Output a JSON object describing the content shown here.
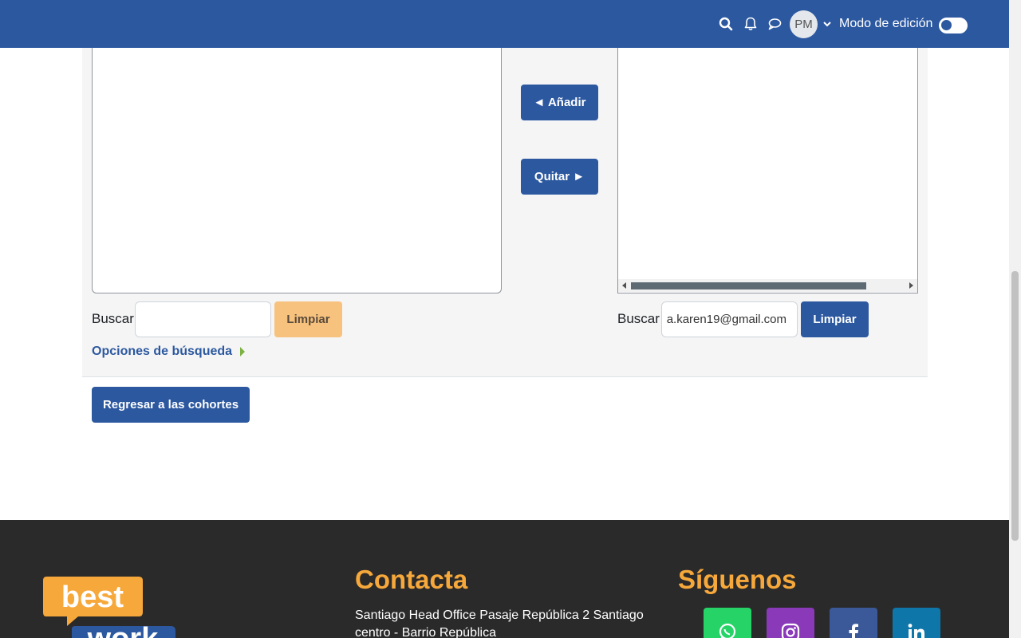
{
  "navbar": {
    "avatar_initials": "PM",
    "edit_mode_label": "Modo de edición"
  },
  "assign": {
    "add_button": "◄ Añadir",
    "remove_button": "Quitar ►",
    "left_search_label": "Buscar",
    "left_search_value": "",
    "left_clear_button": "Limpiar",
    "right_search_label": "Buscar",
    "right_search_value": "a.karen19@gmail.com",
    "right_clear_button": "Limpiar",
    "search_options_link": "Opciones de búsqueda"
  },
  "back_button": "Regresar a las cohortes",
  "footer": {
    "logo_text_top": "best",
    "logo_text_bottom": "work",
    "contact_heading": "Contacta",
    "contact_address": "Santiago Head Office Pasaje República 2 Santiago centro - Barrio República",
    "follow_heading": "Síguenos",
    "social": [
      {
        "name": "whatsapp-icon",
        "color": "#25d366"
      },
      {
        "name": "instagram-icon",
        "color": "#8a3ab9"
      },
      {
        "name": "facebook-icon",
        "color": "#3b5998"
      },
      {
        "name": "linkedin-icon",
        "color": "#0e76a8"
      }
    ]
  },
  "colors": {
    "primary": "#2c58a0",
    "accent": "#f7a83b",
    "clear_button_disabled": "#f7c27d",
    "footer_bg": "#2a2a2a"
  }
}
